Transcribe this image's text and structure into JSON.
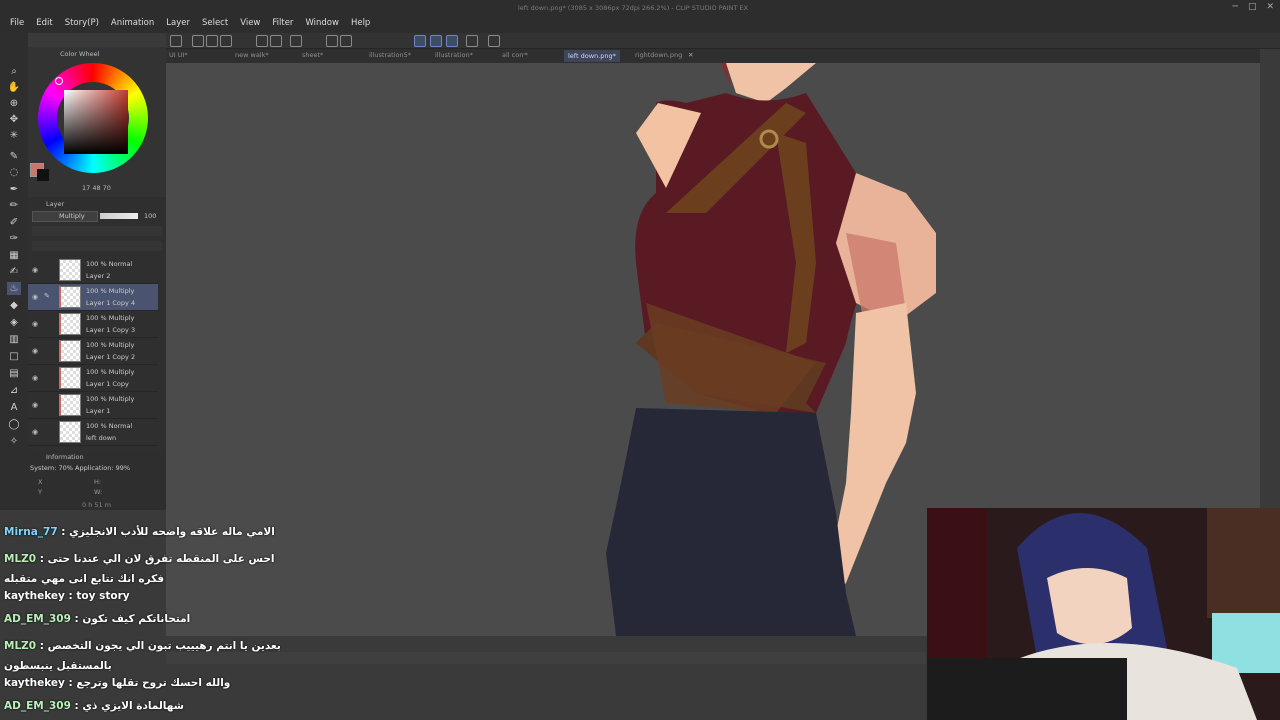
{
  "window": {
    "title": "left down.png* (3085 x 3086px 72dpi 266.2%) - CLIP STUDIO PAINT EX",
    "controls": [
      "─",
      "□",
      "✕"
    ]
  },
  "menu": [
    "File",
    "Edit",
    "Story(P)",
    "Animation",
    "Layer",
    "Select",
    "View",
    "Filter",
    "Window",
    "Help"
  ],
  "tabs": [
    {
      "label": "UI UI*"
    },
    {
      "label": "new walk*"
    },
    {
      "label": "sheet*"
    },
    {
      "label": "illustration5*"
    },
    {
      "label": "illustration*"
    },
    {
      "label": "all corr*"
    },
    {
      "label": "left down.png*",
      "active": true
    },
    {
      "label": "rightdown.png"
    }
  ],
  "color_wheel": {
    "title": "Color Wheel",
    "values": "17  48  70",
    "primary": "#c8766e",
    "secondary": "#111111"
  },
  "layer_panel": {
    "title": "Layer",
    "blend_mode": "Multiply",
    "opacity": "100",
    "layers": [
      {
        "blend": "100 % Normal",
        "name": "Layer 2",
        "selected": false
      },
      {
        "blend": "100 % Multiply",
        "name": "Layer 1 Copy 4",
        "selected": true
      },
      {
        "blend": "100 % Multiply",
        "name": "Layer 1 Copy 3",
        "selected": false
      },
      {
        "blend": "100 % Multiply",
        "name": "Layer 1 Copy 2",
        "selected": false
      },
      {
        "blend": "100 % Multiply",
        "name": "Layer 1 Copy",
        "selected": false
      },
      {
        "blend": "100 % Multiply",
        "name": "Layer 1",
        "selected": false
      },
      {
        "blend": "100 % Normal",
        "name": "left down",
        "selected": false
      }
    ]
  },
  "info_panel": {
    "title": "Information",
    "system": "System: 70%  Application: 99%",
    "x": "X",
    "y": "Y",
    "h": "H:",
    "w": "W:",
    "timer": "0 h 51 m"
  },
  "chat": [
    {
      "user": "Mirna_77",
      "message": "الامي ماله علاقه واضحه للأدب الانجليزي"
    },
    {
      "user": "MLZ0",
      "message": "احس على المنقطه تفرق لان الي عندنا حتى فكره انك تتابع انی مهي متقبله"
    },
    {
      "user": "kaythekey",
      "message": "toy story"
    },
    {
      "user": "AD_EM_309",
      "message": "امتحاناتكم كيف تكون"
    },
    {
      "user": "MLZ0",
      "message": "بعدين يا انتم رهيييب تبون الي يجون التخصص بالمستقبل ينبسطون"
    },
    {
      "user": "kaythekey",
      "message": "والله احسك تروح تقلها وترجع"
    },
    {
      "user": "AD_EM_309",
      "message": "شهالمادة الايزي ذي"
    }
  ]
}
